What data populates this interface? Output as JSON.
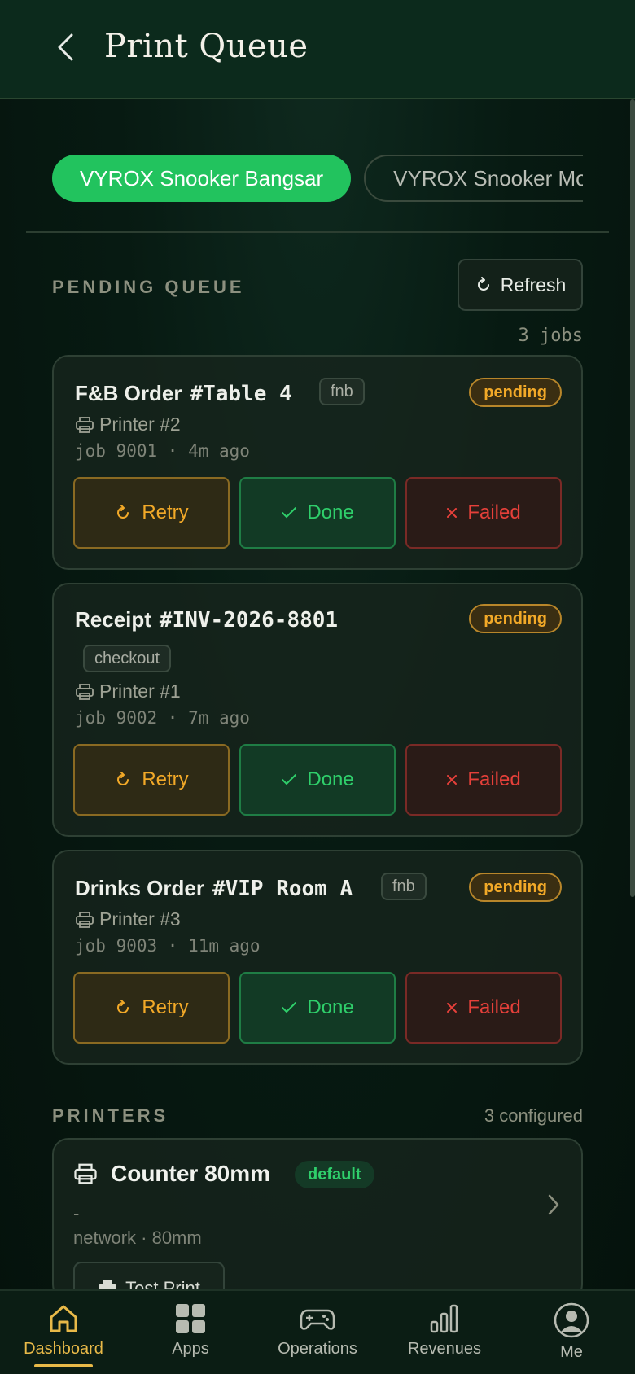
{
  "header": {
    "title": "Print Queue"
  },
  "venues": [
    "VYROX Snooker Bangsar",
    "VYROX Snooker Mont Kiara"
  ],
  "pending": {
    "label": "PENDING QUEUE",
    "refresh_label": "Refresh",
    "count": "3 jobs"
  },
  "jobs": [
    {
      "title": "F&B Order",
      "ref": "#Table 4",
      "tag": "fnb",
      "status": "pending",
      "printer": "Printer #2",
      "job": "job 9001 · 4m ago"
    },
    {
      "title": "Receipt",
      "ref": "#INV-2026-8801",
      "tag": "checkout",
      "status": "pending",
      "printer": "Printer #1",
      "job": "job 9002 · 7m ago"
    },
    {
      "title": "Drinks Order",
      "ref": "#VIP Room A",
      "tag": "fnb",
      "status": "pending",
      "printer": "Printer #3",
      "job": "job 9003 · 11m ago"
    }
  ],
  "actions": {
    "retry": "Retry",
    "done": "Done",
    "failed": "Failed"
  },
  "printers": {
    "label": "PRINTERS",
    "count": "3 configured",
    "items": [
      {
        "name": "Counter 80mm",
        "badge": "default",
        "address": "-",
        "meta": "network · 80mm",
        "test_label": "Test Print"
      }
    ]
  },
  "nav": [
    {
      "label": "Dashboard",
      "icon": "home-icon",
      "active": true
    },
    {
      "label": "Apps",
      "icon": "apps-grid-icon"
    },
    {
      "label": "Operations",
      "icon": "gamepad-icon"
    },
    {
      "label": "Revenues",
      "icon": "bar-chart-icon"
    },
    {
      "label": "Me",
      "icon": "user-avatar-icon"
    }
  ],
  "colors": {
    "accent_green": "#22c35e",
    "pending_amber": "#f2a928",
    "failed_red": "#e6403a",
    "nav_active": "#e8b948"
  }
}
